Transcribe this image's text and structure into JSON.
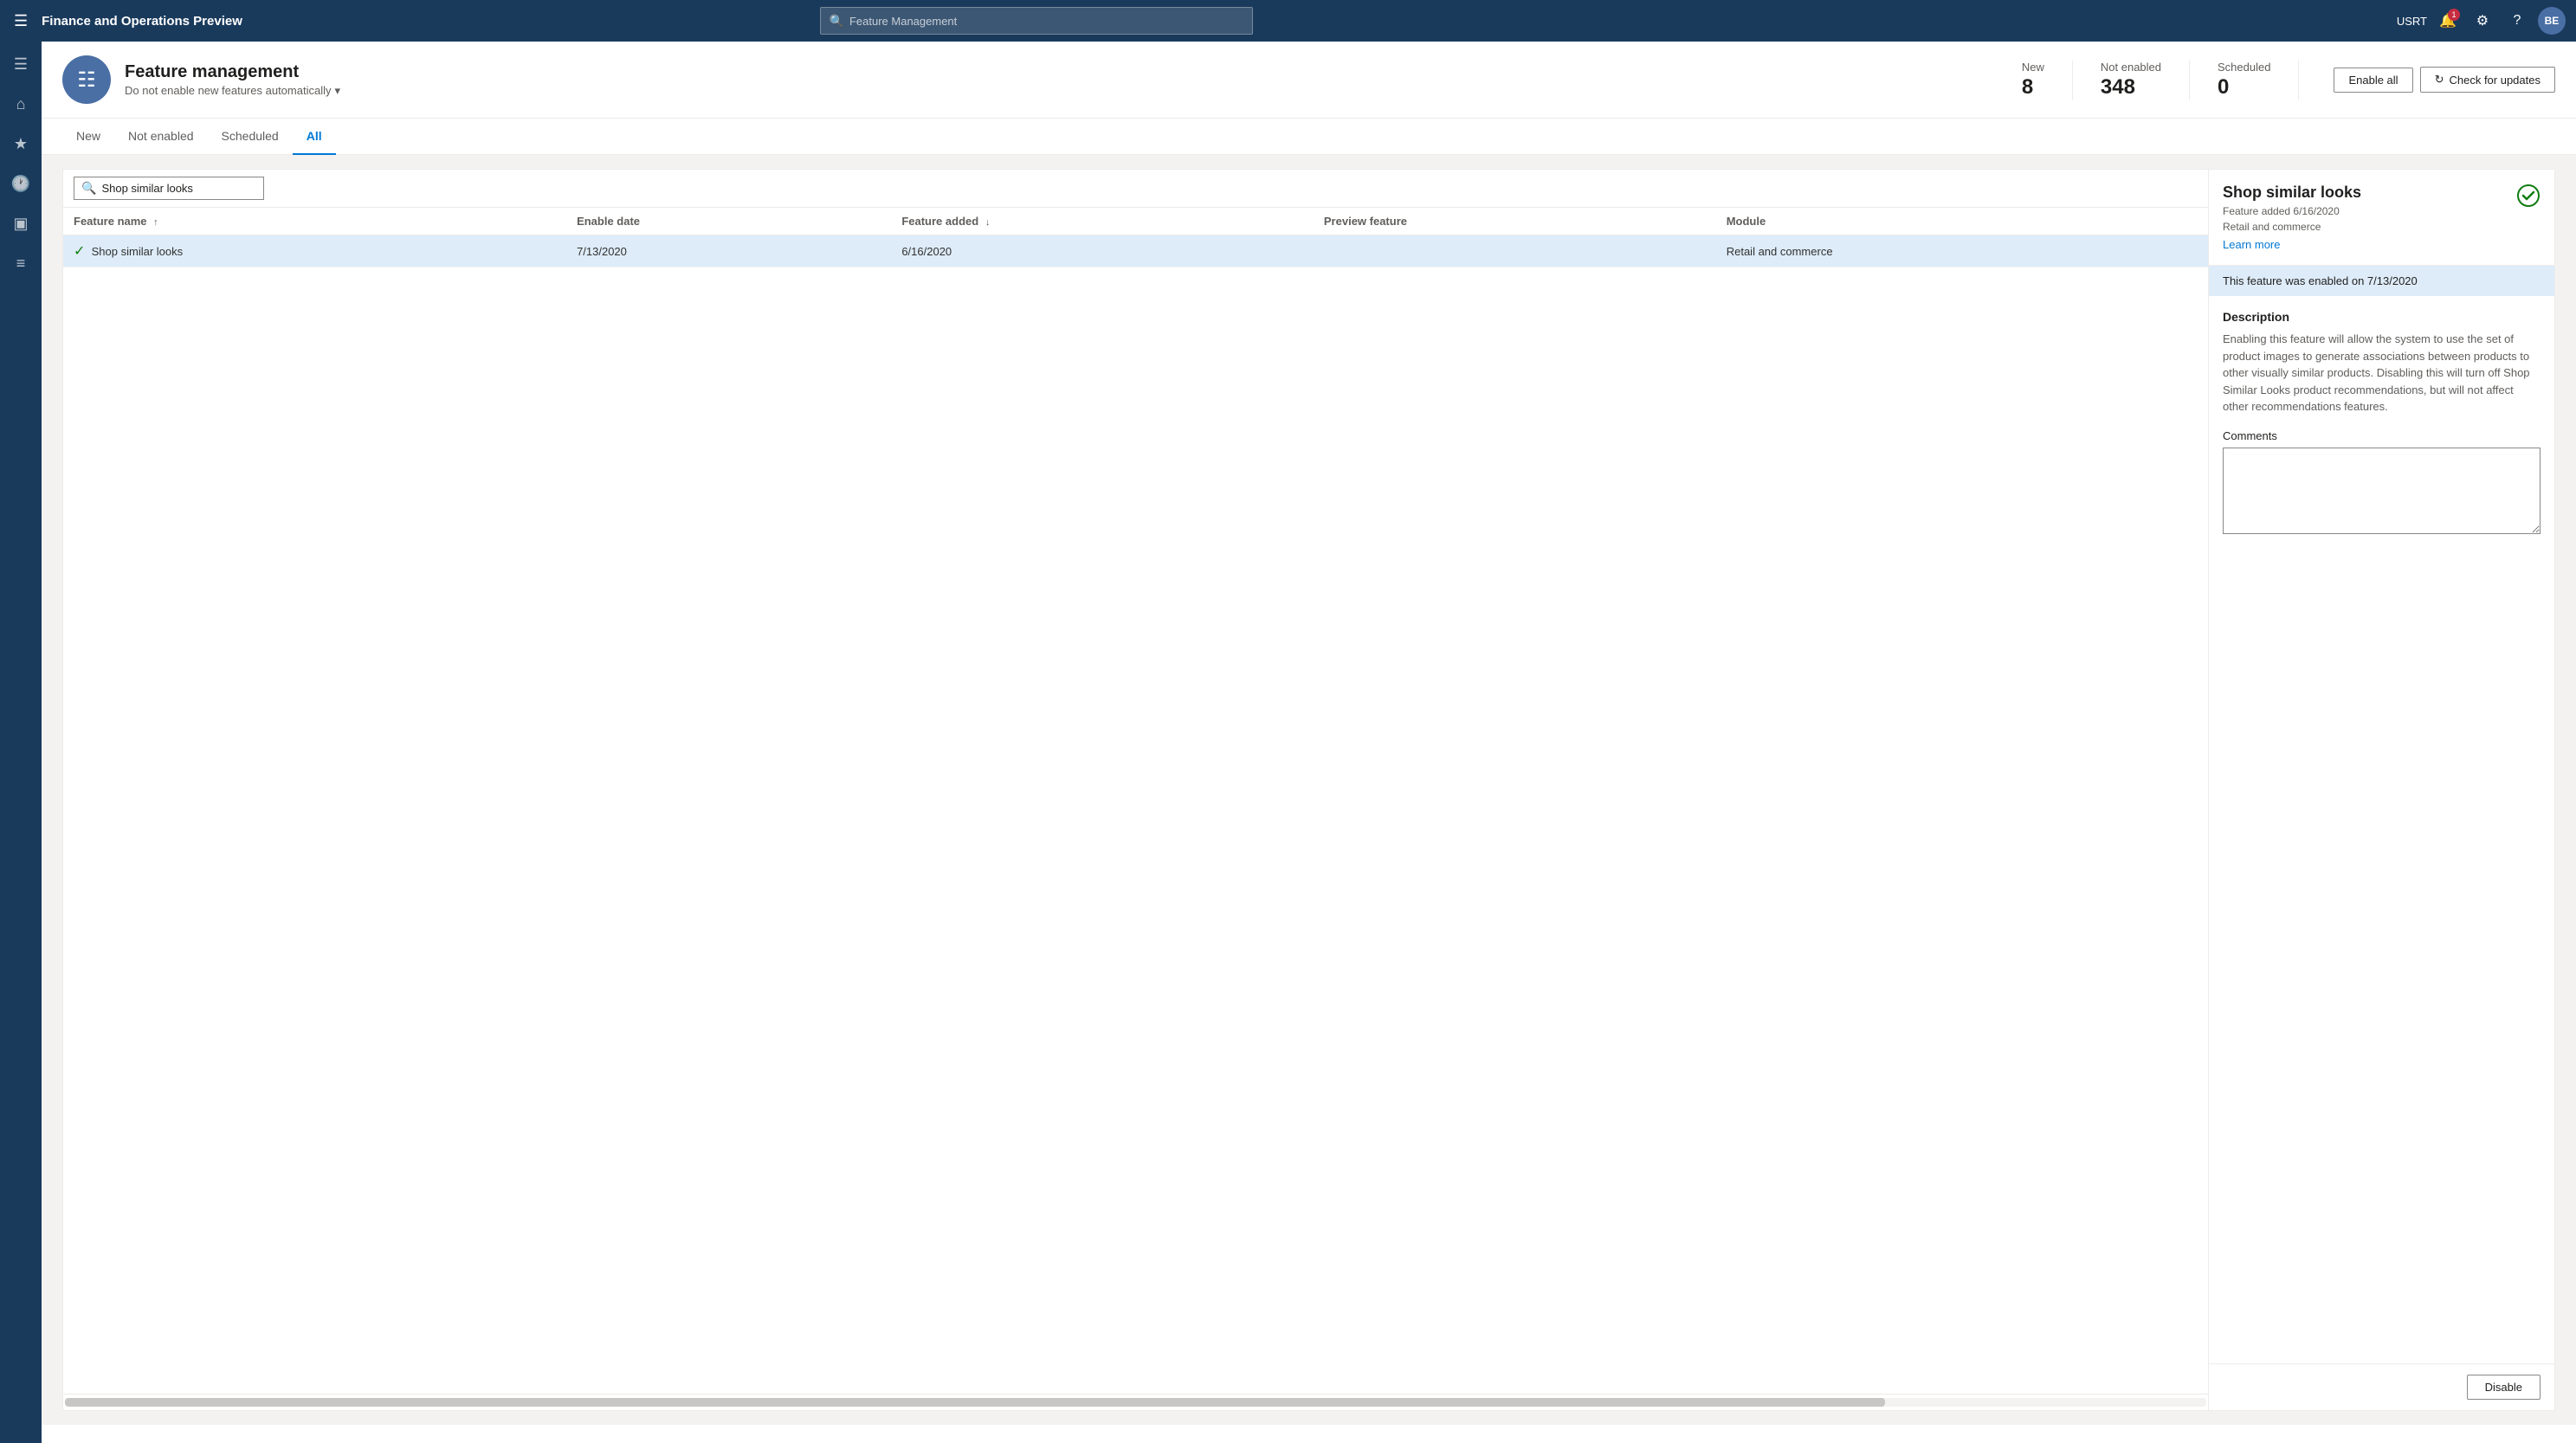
{
  "app": {
    "title": "Finance and Operations Preview",
    "search_placeholder": "Feature Management"
  },
  "nav": {
    "user": "USRT",
    "avatar_initials": "BE",
    "notification_count": "1"
  },
  "sidebar": {
    "icons": [
      "☰",
      "⊞",
      "★",
      "⏱",
      "📊",
      "☰"
    ]
  },
  "page": {
    "icon": "☰",
    "title": "Feature management",
    "subtitle": "Do not enable new features automatically",
    "subtitle_chevron": "▾"
  },
  "stats": [
    {
      "label": "New",
      "value": "8"
    },
    {
      "label": "Not enabled",
      "value": "348"
    },
    {
      "label": "Scheduled",
      "value": "0"
    }
  ],
  "buttons": {
    "enable_all": "Enable all",
    "check_updates": "Check for updates"
  },
  "tabs": [
    {
      "id": "new",
      "label": "New"
    },
    {
      "id": "not-enabled",
      "label": "Not enabled"
    },
    {
      "id": "scheduled",
      "label": "Scheduled"
    },
    {
      "id": "all",
      "label": "All",
      "active": true
    }
  ],
  "search": {
    "placeholder": "Shop similar looks",
    "value": "Shop similar looks"
  },
  "table": {
    "columns": [
      {
        "id": "feature-name",
        "label": "Feature name",
        "sort": "asc"
      },
      {
        "id": "enable-date",
        "label": "Enable date",
        "sort": null
      },
      {
        "id": "feature-added",
        "label": "Feature added",
        "sort": "desc"
      },
      {
        "id": "preview-feature",
        "label": "Preview feature",
        "sort": null
      },
      {
        "id": "module",
        "label": "Module",
        "sort": null
      }
    ],
    "rows": [
      {
        "name": "Shop similar looks",
        "enabled": true,
        "enable_date": "7/13/2020",
        "feature_added": "6/16/2020",
        "preview_feature": "",
        "module": "Retail and commerce",
        "selected": true
      }
    ]
  },
  "detail": {
    "title": "Shop similar looks",
    "feature_added_label": "Feature added 6/16/2020",
    "module": "Retail and commerce",
    "learn_more": "Learn more",
    "enabled_banner": "This feature was enabled on 7/13/2020",
    "description_title": "Description",
    "description": "Enabling this feature will allow the system to use the set of product images to generate associations between products to other visually similar products. Disabling this will turn off Shop Similar Looks product recommendations, but will not affect other recommendations features.",
    "comments_label": "Comments",
    "comments_placeholder": "",
    "disable_button": "Disable"
  }
}
